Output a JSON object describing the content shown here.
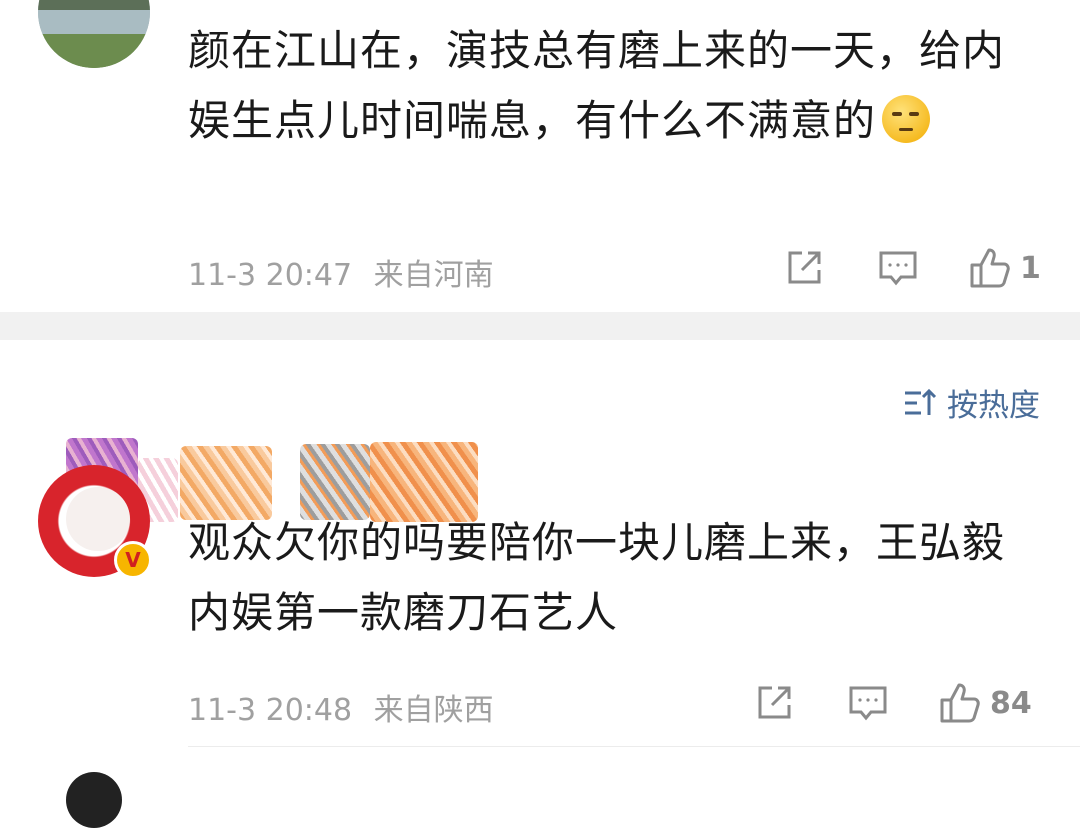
{
  "comments": [
    {
      "text": "颜在江山在，演技总有磨上来的一天，给内娱生点儿时间喘息，有什么不满意的",
      "emoji": "thinking-face-emoji",
      "date": "11-3 20:47",
      "location": "来自河南",
      "likes": "1"
    },
    {
      "text": "观众欠你的吗要陪你一块儿磨上来，王弘毅内娱第一款磨刀石艺人",
      "date": "11-3 20:48",
      "location": "来自陕西",
      "likes": "84",
      "badge": "V"
    }
  ],
  "sort": {
    "label": "按热度",
    "icon": "sort-icon"
  },
  "icons": {
    "share": "share-icon",
    "reply": "comment-icon",
    "like": "thumbs-up-icon"
  },
  "colors": {
    "accent": "#4a6d99",
    "meta": "#a0a0a0",
    "separator": "#f1f1f1",
    "badge": "#f7b500"
  }
}
